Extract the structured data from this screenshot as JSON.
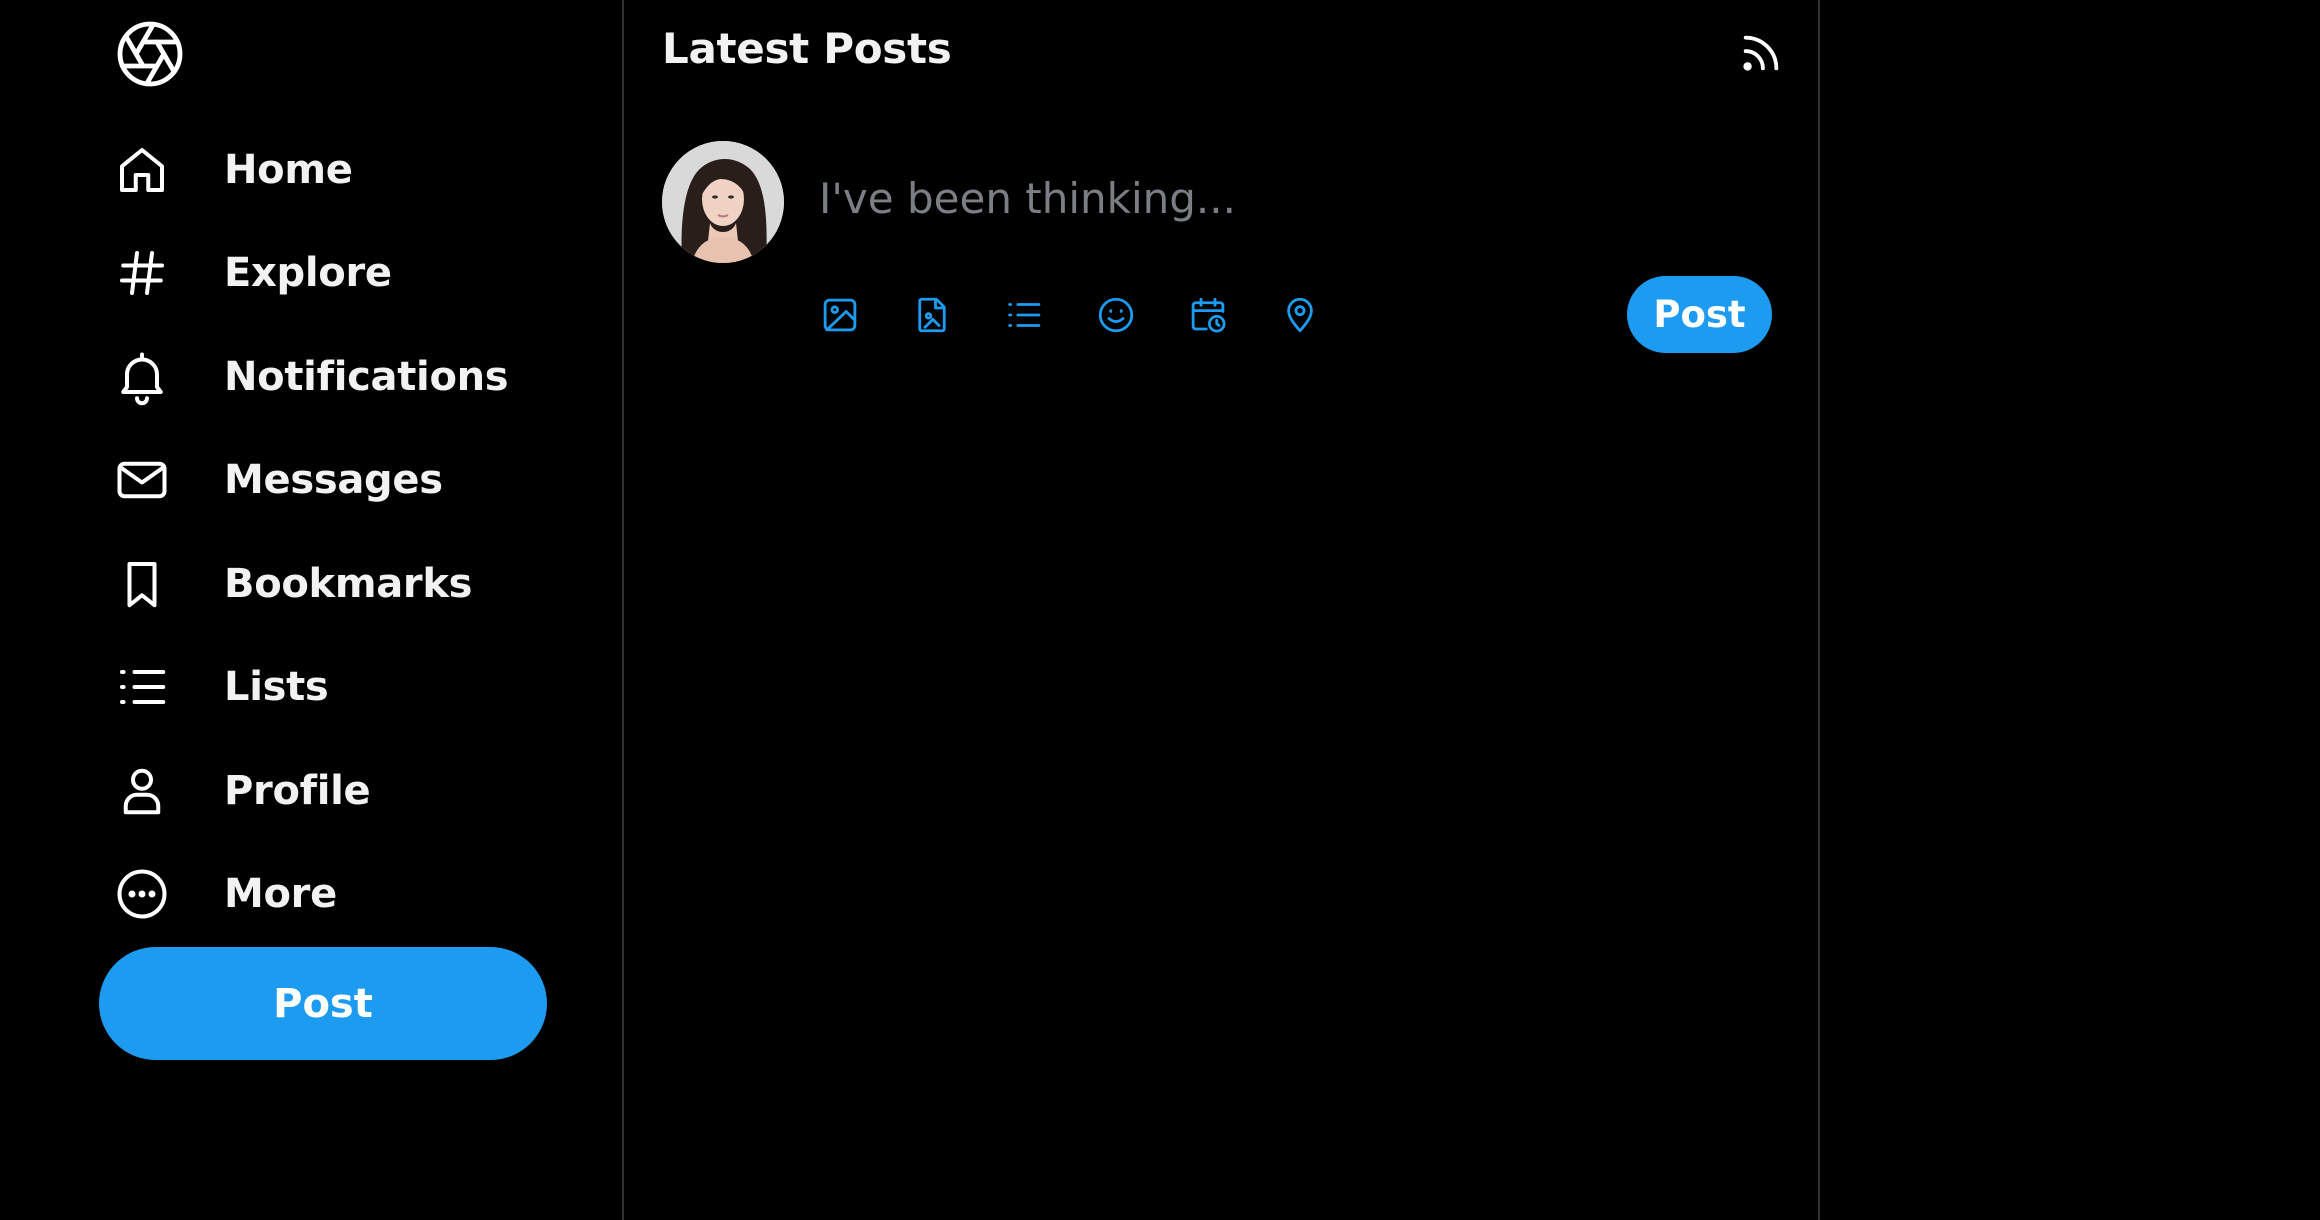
{
  "sidebar": {
    "logo_icon": "aperture-logo-icon",
    "items": [
      {
        "label": "Home",
        "icon": "home-icon"
      },
      {
        "label": "Explore",
        "icon": "hashtag-icon"
      },
      {
        "label": "Notifications",
        "icon": "bell-icon"
      },
      {
        "label": "Messages",
        "icon": "mail-icon"
      },
      {
        "label": "Bookmarks",
        "icon": "bookmark-icon"
      },
      {
        "label": "Lists",
        "icon": "list-icon"
      },
      {
        "label": "Profile",
        "icon": "user-icon"
      },
      {
        "label": "More",
        "icon": "more-circle-icon"
      }
    ],
    "post_button": "Post"
  },
  "main": {
    "title": "Latest Posts",
    "header_icon": "rss-icon",
    "composer": {
      "placeholder": "I've been thinking...",
      "value": "",
      "tools": [
        "image-icon",
        "gif-file-icon",
        "poll-list-icon",
        "emoji-icon",
        "schedule-icon",
        "location-icon"
      ],
      "post_button": "Post"
    }
  },
  "colors": {
    "background": "#000000",
    "accent": "#1d9bf0",
    "text": "#f2f2f2",
    "placeholder": "#7b7f84",
    "divider": "#2f3336"
  }
}
